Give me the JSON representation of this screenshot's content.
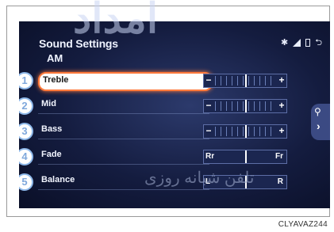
{
  "window": {
    "title": "Sound Settings",
    "source": "AM"
  },
  "status": {
    "icons": [
      "bluetooth-icon",
      "signal-icon",
      "battery-icon"
    ],
    "back_icon": "return-icon"
  },
  "rows": [
    {
      "num": "1",
      "label": "Treble",
      "selected": true,
      "left": "−",
      "right": "+",
      "level": 0.5
    },
    {
      "num": "2",
      "label": "Mid",
      "selected": false,
      "left": "−",
      "right": "+",
      "level": 0.5
    },
    {
      "num": "3",
      "label": "Bass",
      "selected": false,
      "left": "−",
      "right": "+",
      "level": 0.5
    },
    {
      "num": "4",
      "label": "Fade",
      "selected": false,
      "left": "Rr",
      "right": "Fr",
      "level": 0.5
    },
    {
      "num": "5",
      "label": "Balance",
      "selected": false,
      "left": "L",
      "right": "R",
      "level": 0.5
    }
  ],
  "side_tab": {
    "icon": "search-icon",
    "chevron": "›"
  },
  "watermarks": {
    "top": "امداد",
    "bottom": "تلفن شبانه روزی"
  },
  "caption": "CLYAVAZ244"
}
